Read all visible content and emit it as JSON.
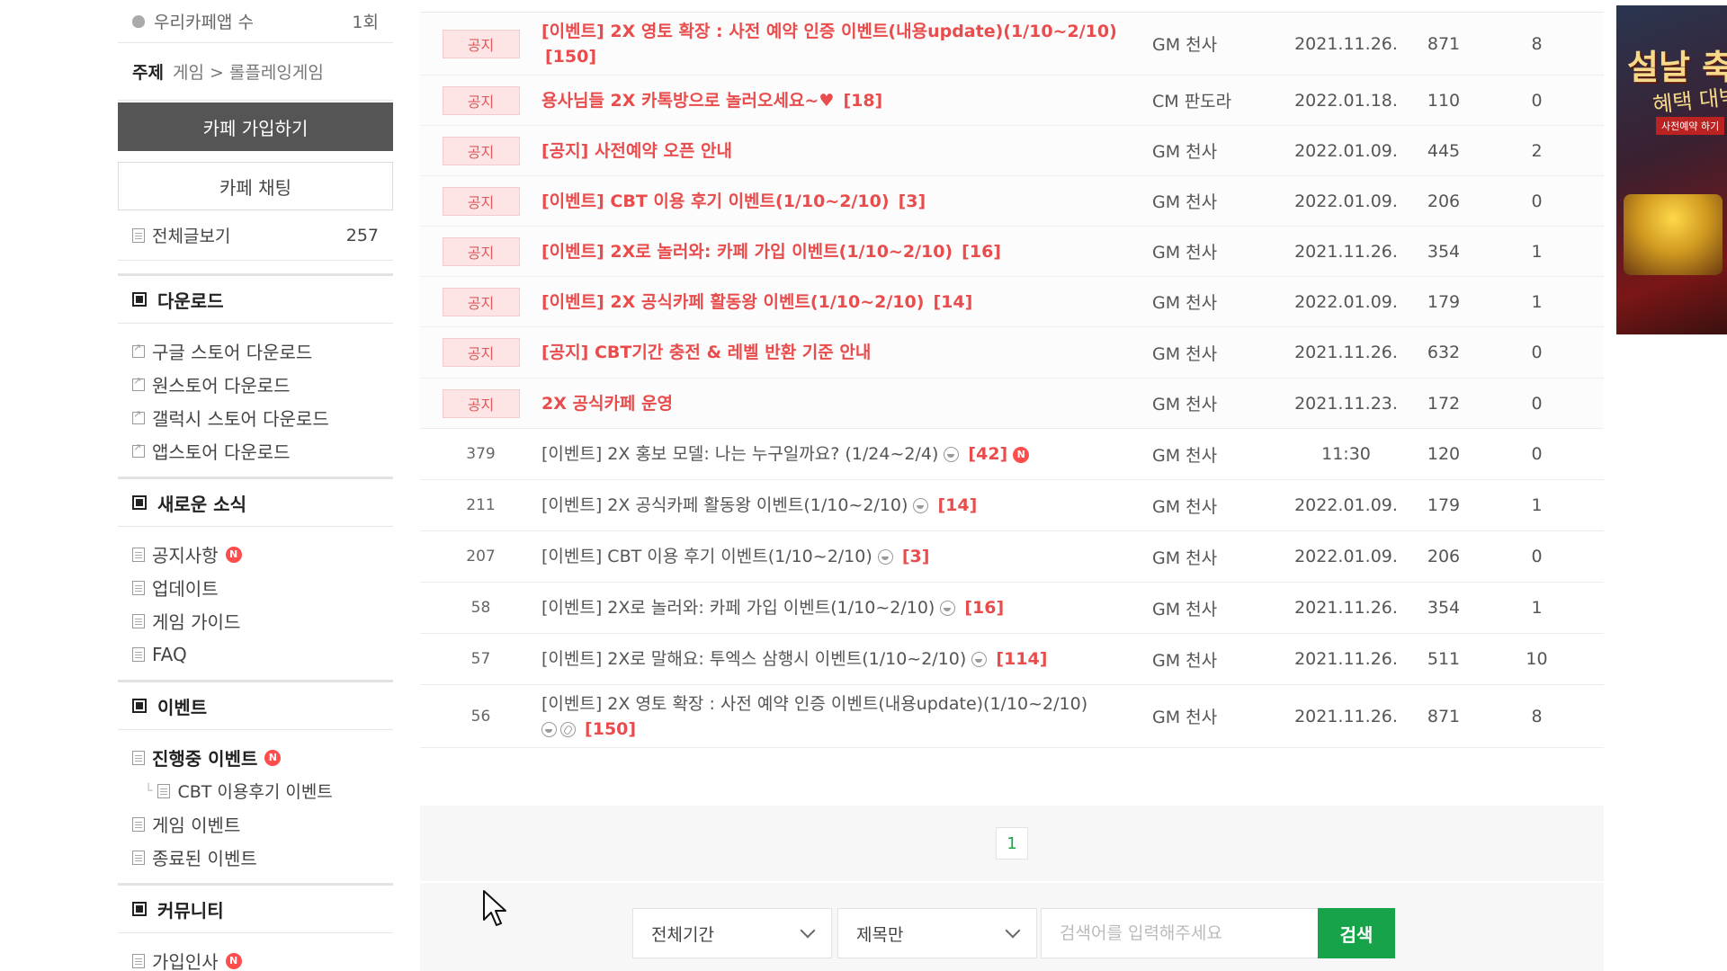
{
  "sidebar": {
    "app_count_label": "우리카페앱 수",
    "app_count_value": "1회",
    "theme_label": "주제",
    "theme_path": "게임 > 롤플레잉게임",
    "join_button": "카페 가입하기",
    "chat_button": "카페 채팅",
    "all_posts_label": "전체글보기",
    "all_posts_count": "257",
    "sections": [
      {
        "title": "다운로드",
        "items": [
          {
            "label": "구글 스토어 다운로드"
          },
          {
            "label": "원스토어 다운로드"
          },
          {
            "label": "갤럭시 스토어 다운로드"
          },
          {
            "label": "앱스토어 다운로드"
          }
        ]
      },
      {
        "title": "새로운 소식",
        "items": [
          {
            "label": "공지사항"
          },
          {
            "label": "업데이트"
          },
          {
            "label": "게임 가이드"
          },
          {
            "label": "FAQ"
          }
        ]
      },
      {
        "title": "이벤트",
        "items": [
          {
            "label": "진행중 이벤트"
          },
          {
            "label": "CBT 이용후기 이벤트"
          },
          {
            "label": "게임 이벤트"
          },
          {
            "label": "종료된 이벤트"
          }
        ]
      },
      {
        "title": "커뮤니티",
        "items": [
          {
            "label": "가입인사"
          }
        ]
      }
    ],
    "new_badge": "N"
  },
  "posts": {
    "notice_label": "공지",
    "notices": [
      {
        "title": "[이벤트] 2X 영토 확장 : 사전 예약 인증 이벤트(내용update)(1/10~2/10)",
        "comments": "[150]",
        "author": "GM 천사",
        "date": "2021.11.26.",
        "views": "871",
        "likes": "8"
      },
      {
        "title": "용사님들 2X 카톡방으로 놀러오세요~♥",
        "comments": "[18]",
        "author": "CM 판도라",
        "date": "2022.01.18.",
        "views": "110",
        "likes": "0"
      },
      {
        "title": "[공지] 사전예약 오픈 안내",
        "comments": "",
        "author": "GM 천사",
        "date": "2022.01.09.",
        "views": "445",
        "likes": "2"
      },
      {
        "title": "[이벤트] CBT 이용 후기 이벤트(1/10~2/10)",
        "comments": "[3]",
        "author": "GM 천사",
        "date": "2022.01.09.",
        "views": "206",
        "likes": "0"
      },
      {
        "title": "[이벤트] 2X로 놀러와: 카페 가입 이벤트(1/10~2/10)",
        "comments": "[16]",
        "author": "GM 천사",
        "date": "2021.11.26.",
        "views": "354",
        "likes": "1"
      },
      {
        "title": "[이벤트] 2X 공식카페 활동왕 이벤트(1/10~2/10)",
        "comments": "[14]",
        "author": "GM 천사",
        "date": "2022.01.09.",
        "views": "179",
        "likes": "1"
      },
      {
        "title": "[공지] CBT기간 충전 & 레벨 반환 기준 안내",
        "comments": "",
        "author": "GM 천사",
        "date": "2021.11.26.",
        "views": "632",
        "likes": "0"
      },
      {
        "title": "2X 공식카페 운영",
        "comments": "",
        "author": "GM 천사",
        "date": "2021.11.23.",
        "views": "172",
        "likes": "0"
      }
    ],
    "articles": [
      {
        "no": "379",
        "title": "[이벤트] 2X 홍보 모델: 나는 누구일까요? (1/24~2/4)",
        "comments": "[42]",
        "author": "GM 천사",
        "date": "11:30",
        "views": "120",
        "likes": "0"
      },
      {
        "no": "211",
        "title": "[이벤트] 2X 공식카페 활동왕 이벤트(1/10~2/10)",
        "comments": "[14]",
        "author": "GM 천사",
        "date": "2022.01.09.",
        "views": "179",
        "likes": "1"
      },
      {
        "no": "207",
        "title": "[이벤트] CBT 이용 후기 이벤트(1/10~2/10)",
        "comments": "[3]",
        "author": "GM 천사",
        "date": "2022.01.09.",
        "views": "206",
        "likes": "0"
      },
      {
        "no": "58",
        "title": "[이벤트] 2X로 놀러와: 카페 가입 이벤트(1/10~2/10)",
        "comments": "[16]",
        "author": "GM 천사",
        "date": "2021.11.26.",
        "views": "354",
        "likes": "1"
      },
      {
        "no": "57",
        "title": "[이벤트] 2X로 말해요: 투엑스 삼행시 이벤트(1/10~2/10)",
        "comments": "[114]",
        "author": "GM 천사",
        "date": "2021.11.26.",
        "views": "511",
        "likes": "10"
      },
      {
        "no": "56",
        "title": "[이벤트] 2X 영토 확장 : 사전 예약 인증 이벤트(내용update)(1/10~2/10)",
        "comments": "[150]",
        "author": "GM 천사",
        "date": "2021.11.26.",
        "views": "871",
        "likes": "8"
      }
    ]
  },
  "pagination": {
    "current": "1"
  },
  "search": {
    "period": "전체기간",
    "scope": "제목만",
    "placeholder": "검색어를 입력해주세요",
    "button": "검색"
  },
  "banner": {
    "title": "설날 축제",
    "subtitle": "혜택 대박",
    "tag": "사전예약 하기"
  },
  "colors": {
    "accent_green": "#16a34a",
    "notice_red": "#e84c4c",
    "new_badge": "#ff4d4d",
    "join_button_bg": "#555555"
  }
}
